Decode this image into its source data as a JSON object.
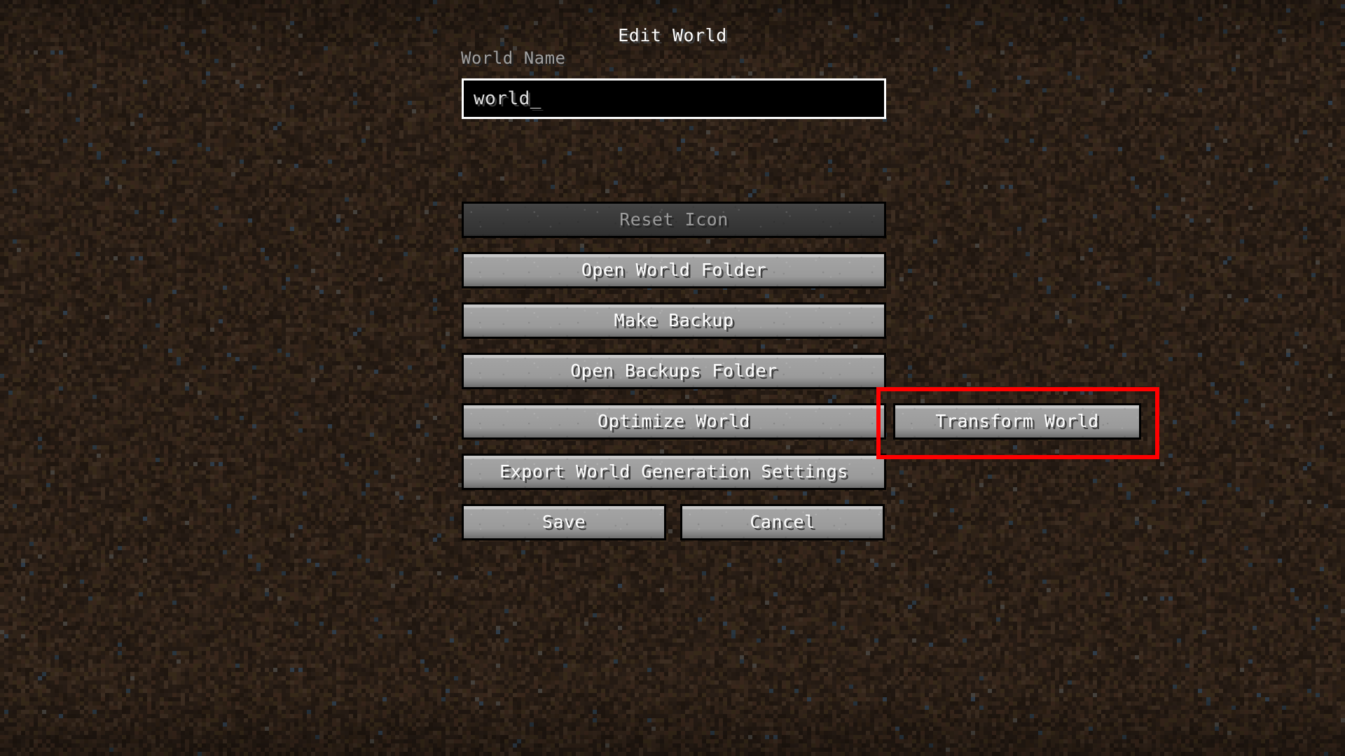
{
  "screen": {
    "title": "Edit World",
    "background": "#33251b"
  },
  "world_name": {
    "label": "World Name",
    "value": "world_",
    "placeholder": ""
  },
  "buttons": {
    "reset_icon": {
      "label": "Reset Icon",
      "enabled": false
    },
    "open_world_folder": {
      "label": "Open World Folder",
      "enabled": true
    },
    "make_backup": {
      "label": "Make Backup",
      "enabled": true
    },
    "open_backups_folder": {
      "label": "Open Backups Folder",
      "enabled": true
    },
    "optimize_world": {
      "label": "Optimize World",
      "enabled": true
    },
    "transform_world": {
      "label": "Transform World",
      "enabled": true
    },
    "export_world_generation_settings": {
      "label": "Export World Generation Settings",
      "enabled": true
    },
    "save": {
      "label": "Save",
      "enabled": true
    },
    "cancel": {
      "label": "Cancel",
      "enabled": true
    }
  },
  "annotation": {
    "color": "#ff0000",
    "target": "transform_world"
  },
  "colors": {
    "button_face": "#9a9a9a",
    "button_disabled_face": "#3b3b3b",
    "text": "#ffffff",
    "text_disabled": "#9b9b9b",
    "label": "#a0a0a0",
    "field_background": "#000000",
    "field_border": "#ffffff",
    "highlight": "#ff0000"
  }
}
